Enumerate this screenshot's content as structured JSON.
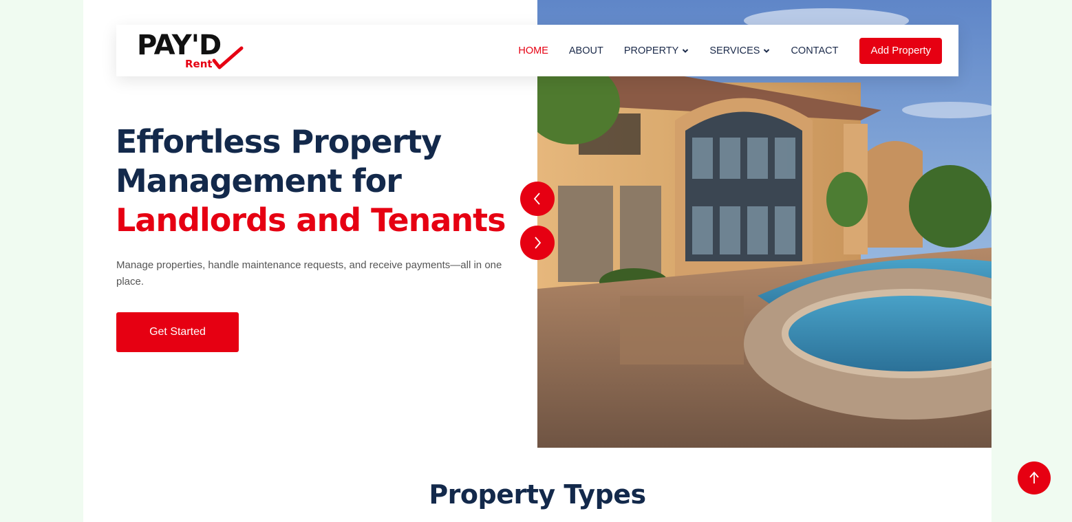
{
  "brand": {
    "logo_main": "PAY'D",
    "logo_sub": "Rent",
    "accent_color": "#e60012",
    "dark_color": "#13294b"
  },
  "nav": {
    "items": [
      {
        "label": "HOME",
        "active": true,
        "dropdown": false
      },
      {
        "label": "ABOUT",
        "active": false,
        "dropdown": false
      },
      {
        "label": "PROPERTY",
        "active": false,
        "dropdown": true
      },
      {
        "label": "SERVICES",
        "active": false,
        "dropdown": true
      },
      {
        "label": "CONTACT",
        "active": false,
        "dropdown": false
      }
    ],
    "add_property_label": "Add Property"
  },
  "hero": {
    "title_line1": "Effortless Property",
    "title_line2": "Management for",
    "title_accent": "Landlords and Tenants",
    "subtitle": "Manage properties, handle maintenance requests, and receive payments—all in one place.",
    "cta_label": "Get Started",
    "prev_icon": "chevron-left-icon",
    "next_icon": "chevron-right-icon"
  },
  "section": {
    "title": "Property Types"
  },
  "back_to_top_icon": "arrow-up-icon"
}
